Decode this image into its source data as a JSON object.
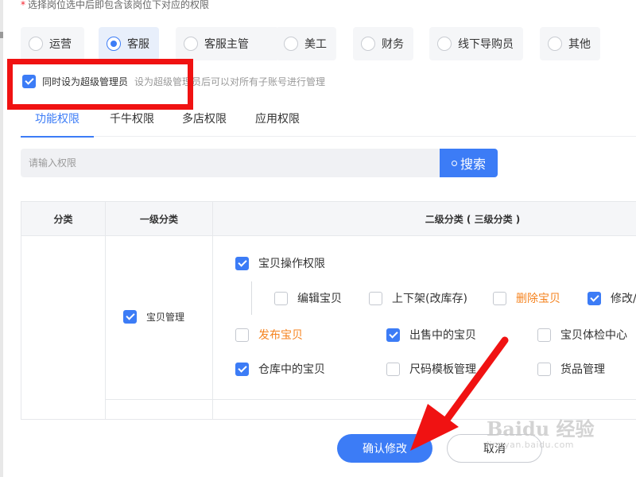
{
  "hint": {
    "star": "*",
    "text": "选择岗位选中后即包含该岗位下对应的权限"
  },
  "roles": [
    {
      "label": "运营",
      "selected": false
    },
    {
      "label": "客服",
      "selected": true
    },
    {
      "label": "客服主管",
      "selected": false
    },
    {
      "label": "美工",
      "selected": false
    },
    {
      "label": "财务",
      "selected": false
    },
    {
      "label": "线下导购员",
      "selected": false
    },
    {
      "label": "其他",
      "selected": false
    }
  ],
  "super_admin": {
    "label": "同时设为超级管理员",
    "checked": true,
    "desc": "设为超级管理员后可以对所有子账号进行管理"
  },
  "tabs": [
    "功能权限",
    "千牛权限",
    "多店权限",
    "应用权限"
  ],
  "search": {
    "placeholder": "请输入权限",
    "button": "搜索",
    "value": ""
  },
  "table": {
    "headers": {
      "category": "分类",
      "level1": "一级分类",
      "level2": "二级分类 ( 三级分类 )"
    },
    "level1_item": {
      "label": "宝贝管理",
      "checked": true
    },
    "group": {
      "label": "宝贝操作权限",
      "checked": true
    },
    "sub_items": [
      {
        "label": "编辑宝贝",
        "checked": false,
        "highlight": false
      },
      {
        "label": "上下架(改库存)",
        "checked": false,
        "highlight": false
      },
      {
        "label": "删除宝贝",
        "checked": false,
        "highlight": true
      },
      {
        "label": "修改/",
        "checked": true,
        "highlight": false
      }
    ],
    "items": [
      {
        "label": "发布宝贝",
        "checked": false,
        "highlight": true
      },
      {
        "label": "出售中的宝贝",
        "checked": true,
        "highlight": false
      },
      {
        "label": "宝贝体检中心",
        "checked": false,
        "highlight": false
      },
      {
        "label": "仓库中的宝贝",
        "checked": true,
        "highlight": false
      },
      {
        "label": "尺码模板管理",
        "checked": false,
        "highlight": false
      },
      {
        "label": "货品管理",
        "checked": false,
        "highlight": false
      }
    ]
  },
  "footer": {
    "confirm": "确认修改",
    "cancel": "取消"
  },
  "watermark": {
    "main": "Baidu 经验",
    "sub": "jingyan.baidu.com"
  },
  "colors": {
    "accent": "#3c7cf6",
    "highlight": "#f5831f",
    "annotation": "#f01212"
  }
}
